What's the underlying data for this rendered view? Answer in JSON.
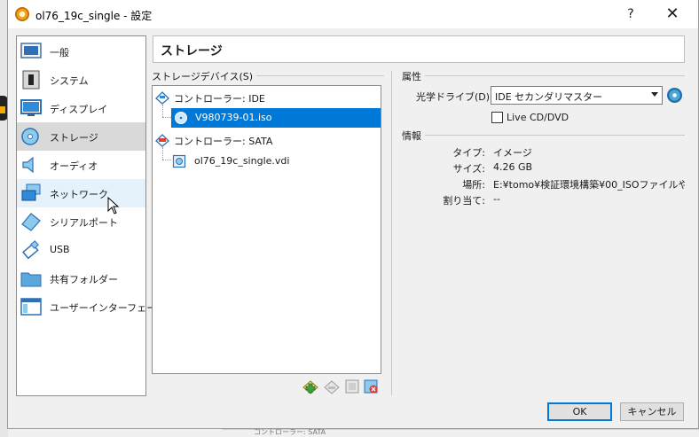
{
  "window": {
    "title": "ol76_19c_single - 設定",
    "help": "?",
    "close": "✕"
  },
  "sidebar": {
    "items": [
      {
        "label": "一般",
        "icon": "general-icon"
      },
      {
        "label": "システム",
        "icon": "system-icon"
      },
      {
        "label": "ディスプレイ",
        "icon": "display-icon"
      },
      {
        "label": "ストレージ",
        "icon": "storage-icon",
        "selected": true
      },
      {
        "label": "オーディオ",
        "icon": "audio-icon"
      },
      {
        "label": "ネットワーク",
        "icon": "network-icon",
        "hover": true
      },
      {
        "label": "シリアルポート",
        "icon": "serial-port-icon"
      },
      {
        "label": "USB",
        "icon": "usb-icon"
      },
      {
        "label": "共有フォルダー",
        "icon": "shared-folder-icon"
      },
      {
        "label": "ユーザーインターフェース",
        "icon": "user-interface-icon"
      }
    ]
  },
  "page": {
    "title": "ストレージ"
  },
  "storage": {
    "group_title": "ストレージデバイス(S)",
    "tree": [
      {
        "label": "コントローラー: IDE",
        "type": "controller"
      },
      {
        "label": "V980739-01.iso",
        "type": "optical",
        "selected": true
      },
      {
        "label": "コントローラー: SATA",
        "type": "controller"
      },
      {
        "label": "ol76_19c_single.vdi",
        "type": "disk"
      }
    ],
    "tools": [
      "add-attachment-icon",
      "remove-attachment-icon",
      "add-controller-icon",
      "remove-controller-icon"
    ]
  },
  "attributes": {
    "group_title": "属性",
    "drive_label": "光学ドライブ(D):",
    "drive_value": "IDE セカンダリマスター",
    "live_cd": "Live CD/DVD",
    "live_cd_checked": false
  },
  "info": {
    "group_title": "情報",
    "rows": [
      {
        "key": "タイプ:",
        "value": "イメージ"
      },
      {
        "key": "サイズ:",
        "value": "4.26 GB"
      },
      {
        "key": "場所:",
        "value": "E:¥tomo¥検証環境構築¥00_ISOファイルや…"
      },
      {
        "key": "割り当て:",
        "value": "--"
      }
    ]
  },
  "buttons": {
    "ok": "OK",
    "cancel": "キャンセル"
  },
  "background": {
    "bottom_text": "コントローラー: SATA"
  }
}
